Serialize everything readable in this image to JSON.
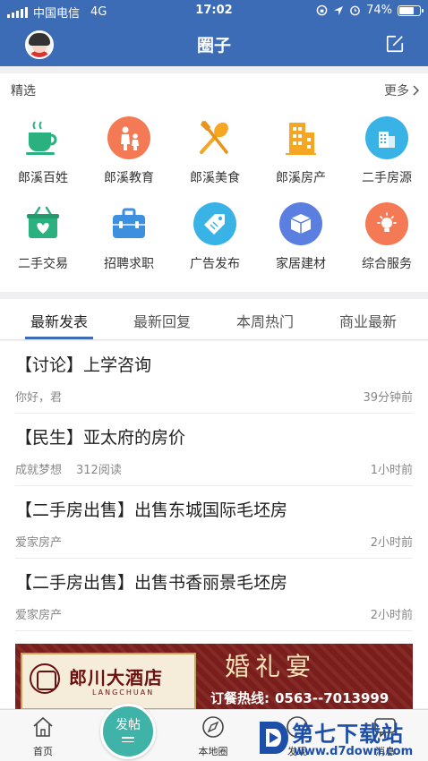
{
  "status_bar": {
    "carrier": "中国电信",
    "network": "4G",
    "time": "17:02",
    "battery": "74%",
    "battery_level": 0.74
  },
  "header": {
    "title": "圈子",
    "compose_icon": "edit-icon"
  },
  "featured": {
    "title": "精选",
    "more_label": "更多",
    "items": [
      {
        "label": "郎溪百姓",
        "icon": "coffee-cup-icon",
        "color": "#2bb07f"
      },
      {
        "label": "郎溪教育",
        "icon": "parent-child-icon",
        "color": "#f37a55"
      },
      {
        "label": "郎溪美食",
        "icon": "fork-spoon-icon",
        "color": "#f5a623"
      },
      {
        "label": "郎溪房产",
        "icon": "building-icon",
        "color": "#f5a623"
      },
      {
        "label": "二手房源",
        "icon": "house-icon",
        "color": "#39b3e6"
      },
      {
        "label": "二手交易",
        "icon": "heart-basket-icon",
        "color": "#2bb07f"
      },
      {
        "label": "招聘求职",
        "icon": "briefcase-icon",
        "color": "#3d8fe0"
      },
      {
        "label": "广告发布",
        "icon": "tag-icon",
        "color": "#39b3e6"
      },
      {
        "label": "家居建材",
        "icon": "box-icon",
        "color": "#5b7fe0"
      },
      {
        "label": "综合服务",
        "icon": "lightbulb-icon",
        "color": "#f37a55"
      }
    ]
  },
  "tabs": [
    {
      "label": "最新发表",
      "active": true
    },
    {
      "label": "最新回复",
      "active": false
    },
    {
      "label": "本周热门",
      "active": false
    },
    {
      "label": "商业最新",
      "active": false
    }
  ],
  "posts": [
    {
      "title": "【讨论】上学咨询",
      "author": "你好，君",
      "reads": "",
      "time": "39分钟前"
    },
    {
      "title": "【民生】亚太府的房价",
      "author": "成就梦想",
      "reads": "312阅读",
      "time": "1小时前"
    },
    {
      "title": "【二手房出售】出售东城国际毛坯房",
      "author": "爱家房产",
      "reads": "",
      "time": "2小时前"
    },
    {
      "title": "【二手房出售】出售书香丽景毛坯房",
      "author": "爱家房产",
      "reads": "",
      "time": "2小时前"
    }
  ],
  "ad": {
    "hotel_name": "郎川大酒店",
    "hotel_sub": "LANGCHUAN",
    "headline": "婚礼宴",
    "hotline_label": "订餐热线:",
    "hotline_number": "0563--7013999"
  },
  "tabbar": {
    "home": "首页",
    "post_button": "发帖",
    "local": "本地圈",
    "discover": "发现",
    "messages": "消息"
  },
  "watermark": {
    "text": "第七下载站",
    "url": "www.d7down.com"
  },
  "colors": {
    "brand": "#3d6cb6",
    "fab": "#3fb3a7"
  }
}
